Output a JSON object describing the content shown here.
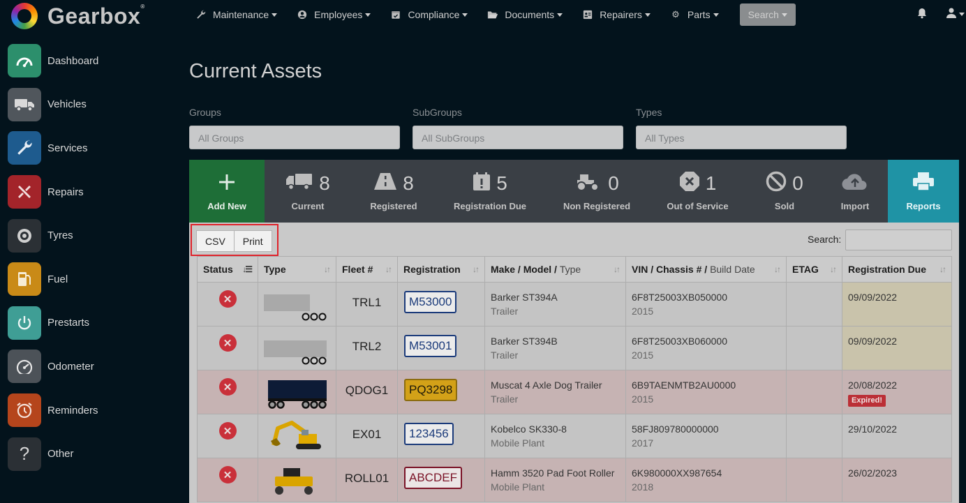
{
  "brand": {
    "name": "Gearbox",
    "mark": "®"
  },
  "nav": {
    "items": [
      {
        "label": "Maintenance",
        "icon": "wrench-icon"
      },
      {
        "label": "Employees",
        "icon": "user-circle-icon"
      },
      {
        "label": "Compliance",
        "icon": "calendar-check-icon"
      },
      {
        "label": "Documents",
        "icon": "folder-open-icon"
      },
      {
        "label": "Repairers",
        "icon": "id-card-icon"
      },
      {
        "label": "Parts",
        "icon": "gear-icon"
      }
    ],
    "search_label": "Search"
  },
  "sidebar": {
    "items": [
      {
        "label": "Dashboard",
        "icon": "gauge-icon",
        "color": "#2c8f6c"
      },
      {
        "label": "Vehicles",
        "icon": "truck-icon",
        "color": "#50565c"
      },
      {
        "label": "Services",
        "icon": "wrench-icon",
        "color": "#1e5b8e"
      },
      {
        "label": "Repairs",
        "icon": "tools-icon",
        "color": "#a3242a"
      },
      {
        "label": "Tyres",
        "icon": "tyre-icon",
        "color": "#2b3035"
      },
      {
        "label": "Fuel",
        "icon": "fuel-pump-icon",
        "color": "#c98a17"
      },
      {
        "label": "Prestarts",
        "icon": "power-icon",
        "color": "#3f9e95"
      },
      {
        "label": "Odometer",
        "icon": "odometer-icon",
        "color": "#4c5258"
      },
      {
        "label": "Reminders",
        "icon": "alarm-clock-icon",
        "color": "#b5451c"
      },
      {
        "label": "Other",
        "icon": "question-icon",
        "color": "#2b3035"
      }
    ]
  },
  "page": {
    "title": "Current Assets",
    "filters": [
      {
        "label": "Groups",
        "placeholder": "All Groups"
      },
      {
        "label": "SubGroups",
        "placeholder": "All SubGroups"
      },
      {
        "label": "Types",
        "placeholder": "All Types"
      }
    ]
  },
  "stats": [
    {
      "label": "Add New",
      "count": "",
      "icon": "plus-icon"
    },
    {
      "label": "Current",
      "count": "8",
      "icon": "truck-icon"
    },
    {
      "label": "Registered",
      "count": "8",
      "icon": "road-icon"
    },
    {
      "label": "Registration Due",
      "count": "5",
      "icon": "calendar-alert-icon"
    },
    {
      "label": "Non Registered",
      "count": "0",
      "icon": "tractor-icon"
    },
    {
      "label": "Out of Service",
      "count": "1",
      "icon": "octagon-x-icon"
    },
    {
      "label": "Sold",
      "count": "0",
      "icon": "ban-icon"
    },
    {
      "label": "Import",
      "count": "",
      "icon": "cloud-upload-icon"
    },
    {
      "label": "Reports",
      "count": "",
      "icon": "printer-icon"
    }
  ],
  "table": {
    "export_buttons": [
      "CSV",
      "Print"
    ],
    "search_label": "Search:",
    "columns": [
      {
        "label": "Status",
        "sub": ""
      },
      {
        "label": "Type",
        "sub": ""
      },
      {
        "label": "Fleet #",
        "sub": ""
      },
      {
        "label": "Registration",
        "sub": ""
      },
      {
        "label": "Make / Model / ",
        "sub": "Type"
      },
      {
        "label": "VIN / Chassis # / ",
        "sub": "Build Date"
      },
      {
        "label": "ETAG",
        "sub": ""
      },
      {
        "label": "Registration Due",
        "sub": ""
      }
    ],
    "rows": [
      {
        "fleet": "TRL1",
        "rego": "M53000",
        "make": "Barker ST394A",
        "type": "Trailer",
        "vin": "6F8T25003XB050000",
        "year": "2015",
        "etag": "",
        "due": "09/09/2022",
        "badge": ""
      },
      {
        "fleet": "TRL2",
        "rego": "M53001",
        "make": "Barker ST394B",
        "type": "Trailer",
        "vin": "6F8T25003XB060000",
        "year": "2015",
        "etag": "",
        "due": "09/09/2022",
        "badge": ""
      },
      {
        "fleet": "QDOG1",
        "rego": "PQ3298",
        "make": "Muscat 4 Axle Dog Trailer",
        "type": "Trailer",
        "vin": "6B9TAENMTB2AU0000",
        "year": "2015",
        "etag": "",
        "due": "20/08/2022",
        "badge": "Expired!"
      },
      {
        "fleet": "EX01",
        "rego": "123456",
        "make": "Kobelco SK330-8",
        "type": "Mobile Plant",
        "vin": "58FJ809780000000",
        "year": "2017",
        "etag": "",
        "due": "29/10/2022",
        "badge": ""
      },
      {
        "fleet": "ROLL01",
        "rego": "ABCDEF",
        "make": "Hamm 3520 Pad Foot Roller",
        "type": "Mobile Plant",
        "vin": "6K980000XX987654",
        "year": "2018",
        "etag": "",
        "due": "26/02/2023",
        "badge": ""
      }
    ]
  },
  "user_menu_icon": "user-icon",
  "notifications_icon": "bell-icon"
}
